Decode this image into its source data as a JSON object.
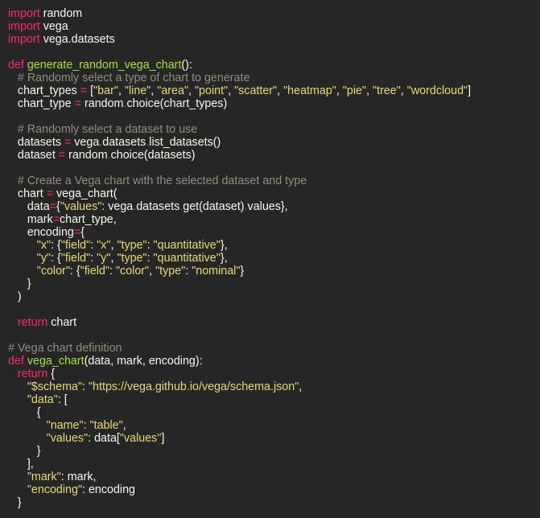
{
  "colors": {
    "background": "#262626",
    "plain": "#f8f8f2",
    "keyword": "#f92672",
    "function": "#a6e22e",
    "string": "#e6db74",
    "comment": "#908d80"
  },
  "lines": [
    [
      [
        "kw",
        "import"
      ],
      [
        "pl",
        " random"
      ]
    ],
    [
      [
        "kw",
        "import"
      ],
      [
        "pl",
        " vega"
      ]
    ],
    [
      [
        "kw",
        "import"
      ],
      [
        "pl",
        " vega.datasets"
      ]
    ],
    [],
    [
      [
        "kw",
        "def "
      ],
      [
        "fn",
        "generate_random_vega_chart"
      ],
      [
        "pl",
        "():"
      ]
    ],
    [
      [
        "pl",
        "   "
      ],
      [
        "cm",
        "# Randomly select a type of chart to generate"
      ]
    ],
    [
      [
        "pl",
        "   chart_types "
      ],
      [
        "op",
        "="
      ],
      [
        "pl",
        " ["
      ],
      [
        "str",
        "\"bar\""
      ],
      [
        "pl",
        ", "
      ],
      [
        "str",
        "\"line\""
      ],
      [
        "pl",
        ", "
      ],
      [
        "str",
        "\"area\""
      ],
      [
        "pl",
        ", "
      ],
      [
        "str",
        "\"point\""
      ],
      [
        "pl",
        ", "
      ],
      [
        "str",
        "\"scatter\""
      ],
      [
        "pl",
        ", "
      ],
      [
        "str",
        "\"heatmap\""
      ],
      [
        "pl",
        ", "
      ],
      [
        "str",
        "\"pie\""
      ],
      [
        "pl",
        ", "
      ],
      [
        "str",
        "\"tree\""
      ],
      [
        "pl",
        ", "
      ],
      [
        "str",
        "\"wordcloud\""
      ],
      [
        "pl",
        "]"
      ]
    ],
    [
      [
        "pl",
        "   chart_type "
      ],
      [
        "op",
        "="
      ],
      [
        "pl",
        " random"
      ],
      [
        "op",
        "."
      ],
      [
        "pl",
        "choice(chart_types)"
      ]
    ],
    [],
    [
      [
        "pl",
        "   "
      ],
      [
        "cm",
        "# Randomly select a dataset to use"
      ]
    ],
    [
      [
        "pl",
        "   datasets "
      ],
      [
        "op",
        "="
      ],
      [
        "pl",
        " vega"
      ],
      [
        "op",
        "."
      ],
      [
        "pl",
        "datasets"
      ],
      [
        "op",
        "."
      ],
      [
        "pl",
        "list_datasets()"
      ]
    ],
    [
      [
        "pl",
        "   dataset "
      ],
      [
        "op",
        "="
      ],
      [
        "pl",
        " random"
      ],
      [
        "op",
        "."
      ],
      [
        "pl",
        "choice(datasets)"
      ]
    ],
    [],
    [
      [
        "pl",
        "   "
      ],
      [
        "cm",
        "# Create a Vega chart with the selected dataset and type"
      ]
    ],
    [
      [
        "pl",
        "   chart "
      ],
      [
        "op",
        "="
      ],
      [
        "pl",
        " vega_chart("
      ]
    ],
    [
      [
        "pl",
        "      data"
      ],
      [
        "op",
        "="
      ],
      [
        "pl",
        "{"
      ],
      [
        "str",
        "\"values\""
      ],
      [
        "pl",
        ": vega"
      ],
      [
        "op",
        "."
      ],
      [
        "pl",
        "datasets"
      ],
      [
        "op",
        "."
      ],
      [
        "pl",
        "get(dataset)"
      ],
      [
        "op",
        "."
      ],
      [
        "pl",
        "values},"
      ]
    ],
    [
      [
        "pl",
        "      mark"
      ],
      [
        "op",
        "="
      ],
      [
        "pl",
        "chart_type,"
      ]
    ],
    [
      [
        "pl",
        "      encoding"
      ],
      [
        "op",
        "="
      ],
      [
        "pl",
        "{"
      ]
    ],
    [
      [
        "pl",
        "         "
      ],
      [
        "str",
        "\"x\""
      ],
      [
        "pl",
        ": {"
      ],
      [
        "str",
        "\"field\""
      ],
      [
        "pl",
        ": "
      ],
      [
        "str",
        "\"x\""
      ],
      [
        "pl",
        ", "
      ],
      [
        "str",
        "\"type\""
      ],
      [
        "pl",
        ": "
      ],
      [
        "str",
        "\"quantitative\""
      ],
      [
        "pl",
        "},"
      ]
    ],
    [
      [
        "pl",
        "         "
      ],
      [
        "str",
        "\"y\""
      ],
      [
        "pl",
        ": {"
      ],
      [
        "str",
        "\"field\""
      ],
      [
        "pl",
        ": "
      ],
      [
        "str",
        "\"y\""
      ],
      [
        "pl",
        ", "
      ],
      [
        "str",
        "\"type\""
      ],
      [
        "pl",
        ": "
      ],
      [
        "str",
        "\"quantitative\""
      ],
      [
        "pl",
        "},"
      ]
    ],
    [
      [
        "pl",
        "         "
      ],
      [
        "str",
        "\"color\""
      ],
      [
        "pl",
        ": {"
      ],
      [
        "str",
        "\"field\""
      ],
      [
        "pl",
        ": "
      ],
      [
        "str",
        "\"color\""
      ],
      [
        "pl",
        ", "
      ],
      [
        "str",
        "\"type\""
      ],
      [
        "pl",
        ": "
      ],
      [
        "str",
        "\"nominal\""
      ],
      [
        "pl",
        "}"
      ]
    ],
    [
      [
        "pl",
        "      }"
      ]
    ],
    [
      [
        "pl",
        "   )"
      ]
    ],
    [],
    [
      [
        "pl",
        "   "
      ],
      [
        "kw",
        "return"
      ],
      [
        "pl",
        " chart"
      ]
    ],
    [],
    [
      [
        "cm",
        "# Vega chart definition"
      ]
    ],
    [
      [
        "kw",
        "def "
      ],
      [
        "fn",
        "vega_chart"
      ],
      [
        "pl",
        "(data, mark, encoding):"
      ]
    ],
    [
      [
        "pl",
        "   "
      ],
      [
        "kw",
        "return"
      ],
      [
        "pl",
        " {"
      ]
    ],
    [
      [
        "pl",
        "      "
      ],
      [
        "str",
        "\"$schema\""
      ],
      [
        "pl",
        ": "
      ],
      [
        "str",
        "\"https://vega.github.io/vega/schema.json\""
      ],
      [
        "pl",
        ","
      ]
    ],
    [
      [
        "pl",
        "      "
      ],
      [
        "str",
        "\"data\""
      ],
      [
        "pl",
        ": ["
      ]
    ],
    [
      [
        "pl",
        "         {"
      ]
    ],
    [
      [
        "pl",
        "            "
      ],
      [
        "str",
        "\"name\""
      ],
      [
        "pl",
        ": "
      ],
      [
        "str",
        "\"table\""
      ],
      [
        "pl",
        ","
      ]
    ],
    [
      [
        "pl",
        "            "
      ],
      [
        "str",
        "\"values\""
      ],
      [
        "pl",
        ": data["
      ],
      [
        "str",
        "\"values\""
      ],
      [
        "pl",
        "]"
      ]
    ],
    [
      [
        "pl",
        "         }"
      ]
    ],
    [
      [
        "pl",
        "      ],"
      ]
    ],
    [
      [
        "pl",
        "      "
      ],
      [
        "str",
        "\"mark\""
      ],
      [
        "pl",
        ": mark,"
      ]
    ],
    [
      [
        "pl",
        "      "
      ],
      [
        "str",
        "\"encoding\""
      ],
      [
        "pl",
        ": encoding"
      ]
    ],
    [
      [
        "pl",
        "   }"
      ]
    ]
  ]
}
